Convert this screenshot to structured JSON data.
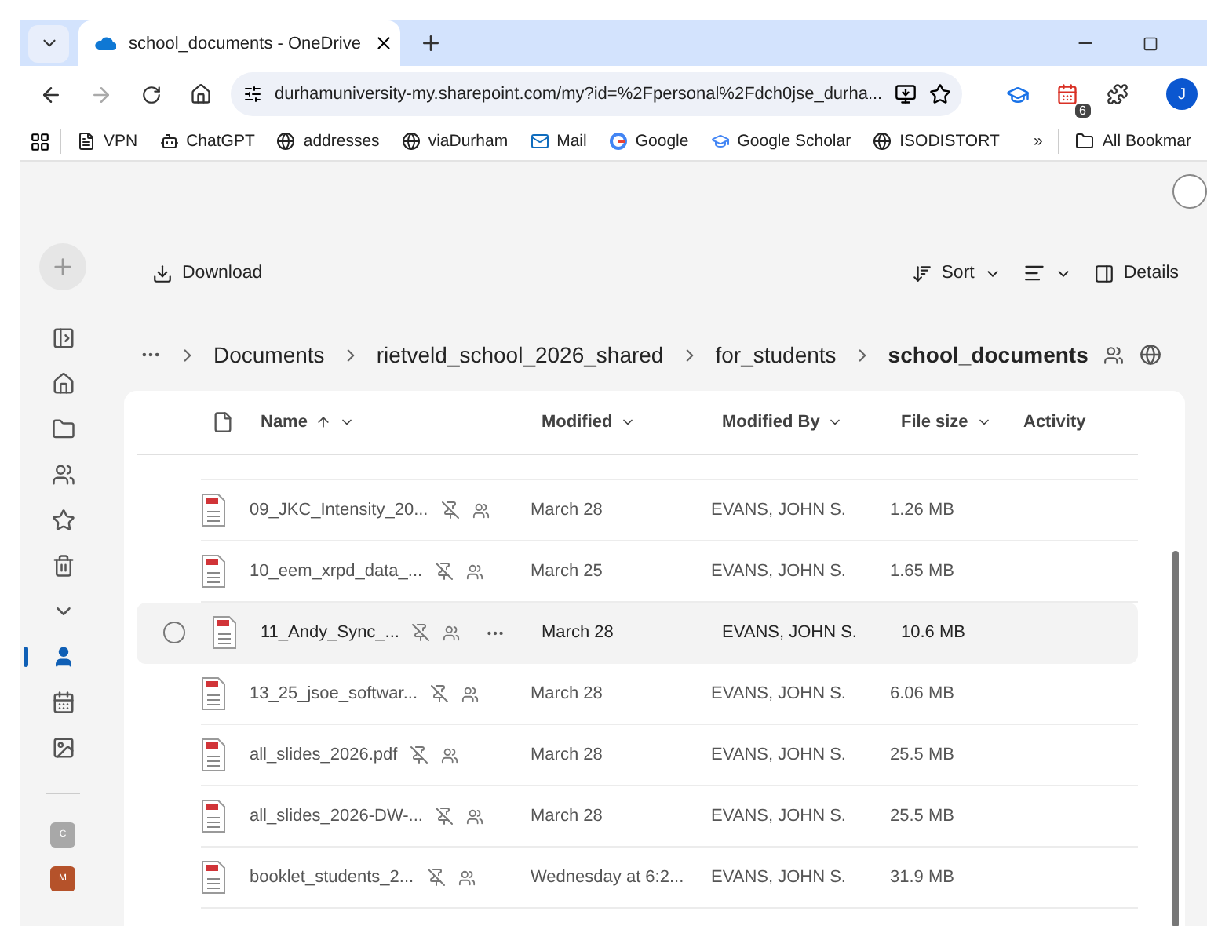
{
  "browser": {
    "tab_title": "school_documents - OneDrive",
    "url": "durhamuniversity-my.sharepoint.com/my?id=%2Fpersonal%2Fdch0jse_durha...",
    "extension_badge": "6",
    "profile_initial": "J",
    "bookmarks": [
      {
        "label": "VPN",
        "kind": "page"
      },
      {
        "label": "ChatGPT",
        "kind": "chat"
      },
      {
        "label": "addresses",
        "kind": "globe"
      },
      {
        "label": "viaDurham",
        "kind": "globe"
      },
      {
        "label": "Mail",
        "kind": "mail"
      },
      {
        "label": "Google",
        "kind": "google"
      },
      {
        "label": "Google Scholar",
        "kind": "scholar"
      },
      {
        "label": "ISODISTORT",
        "kind": "globe"
      }
    ],
    "more_bookmarks": "»",
    "all_bookmarks": "All Bookmar"
  },
  "rail": [
    {
      "kind": "sidebar",
      "selected": false
    },
    {
      "kind": "home",
      "selected": false
    },
    {
      "kind": "folder",
      "selected": false
    },
    {
      "kind": "people",
      "selected": false
    },
    {
      "kind": "star",
      "selected": false
    },
    {
      "kind": "trash",
      "selected": false
    },
    {
      "kind": "collapse",
      "selected": false
    },
    {
      "kind": "person",
      "selected": true
    },
    {
      "kind": "calendar",
      "selected": false
    },
    {
      "kind": "image",
      "selected": false
    }
  ],
  "rail_sites": [
    {
      "initial": "C",
      "color": "#a8a8a8"
    },
    {
      "initial": "M",
      "color": "#b5522a"
    }
  ],
  "toolbar": {
    "download": "Download",
    "sort": "Sort",
    "details": "Details"
  },
  "breadcrumbs": [
    "Documents",
    "rietveld_school_2026_shared",
    "for_students"
  ],
  "current_folder": "school_documents",
  "columns": [
    {
      "label": "Name",
      "sorted": true
    },
    {
      "label": "Modified",
      "sorted": false
    },
    {
      "label": "Modified By",
      "sorted": false
    },
    {
      "label": "File size",
      "sorted": false
    },
    {
      "label": "Activity",
      "sorted": false
    }
  ],
  "rows": [
    {
      "name": "09_JKC_Intensity_20...",
      "modified": "March 28",
      "modified_by": "EVANS, JOHN S.",
      "size": "1.26 MB",
      "hovered": false
    },
    {
      "name": "10_eem_xrpd_data_...",
      "modified": "March 25",
      "modified_by": "EVANS, JOHN S.",
      "size": "1.65 MB",
      "hovered": false
    },
    {
      "name": "11_Andy_Sync_...",
      "modified": "March 28",
      "modified_by": "EVANS, JOHN S.",
      "size": "10.6 MB",
      "hovered": true
    },
    {
      "name": "13_25_jsoe_softwar...",
      "modified": "March 28",
      "modified_by": "EVANS, JOHN S.",
      "size": "6.06 MB",
      "hovered": false
    },
    {
      "name": "all_slides_2026.pdf",
      "modified": "March 28",
      "modified_by": "EVANS, JOHN S.",
      "size": "25.5 MB",
      "hovered": false
    },
    {
      "name": "all_slides_2026-DW-...",
      "modified": "March 28",
      "modified_by": "EVANS, JOHN S.",
      "size": "25.5 MB",
      "hovered": false
    },
    {
      "name": "booklet_students_2...",
      "modified": "Wednesday at 6:2...",
      "modified_by": "EVANS, JOHN S.",
      "size": "31.9 MB",
      "hovered": false
    }
  ]
}
